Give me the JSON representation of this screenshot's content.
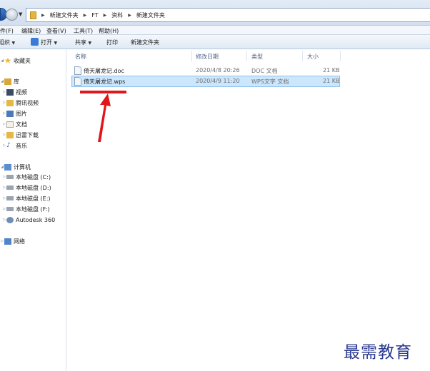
{
  "address_bar": {
    "crumbs": [
      "新建文件夹",
      "FT",
      "资料",
      "新建文件夹"
    ]
  },
  "menu": {
    "items": [
      "件(F)",
      "编辑(E)",
      "查看(V)",
      "工具(T)",
      "帮助(H)"
    ]
  },
  "toolbar": {
    "organize_label": "组织",
    "open_label": "打开",
    "share_label": "共享",
    "print_label": "打印",
    "new_folder_label": "新建文件夹"
  },
  "nav": {
    "favorites": "收藏夹",
    "library": "库",
    "library_items": [
      "视频",
      "腾讯视频",
      "图片",
      "文档",
      "迅雷下载",
      "音乐"
    ],
    "computer": "计算机",
    "drives": [
      "本地磁盘 (C:)",
      "本地磁盘 (D:)",
      "本地磁盘 (E:)",
      "本地磁盘 (F:)",
      "Autodesk 360"
    ],
    "network": "网络"
  },
  "file_list": {
    "columns": [
      "名称",
      "修改日期",
      "类型",
      "大小"
    ],
    "rows": [
      {
        "name": "倚天屠龙记.doc",
        "modified": "2020/4/8 20:26",
        "type": "DOC 文档",
        "size": "21 KB",
        "selected": false
      },
      {
        "name": "倚天屠龙记.wps",
        "modified": "2020/4/9 11:20",
        "type": "WPS文字 文档",
        "size": "21 KB",
        "selected": true
      }
    ]
  },
  "watermark": "最需教育",
  "colors": {
    "annotation": "#e0161b",
    "selection": "#cce6fc",
    "watermark": "#2b3a8f"
  }
}
